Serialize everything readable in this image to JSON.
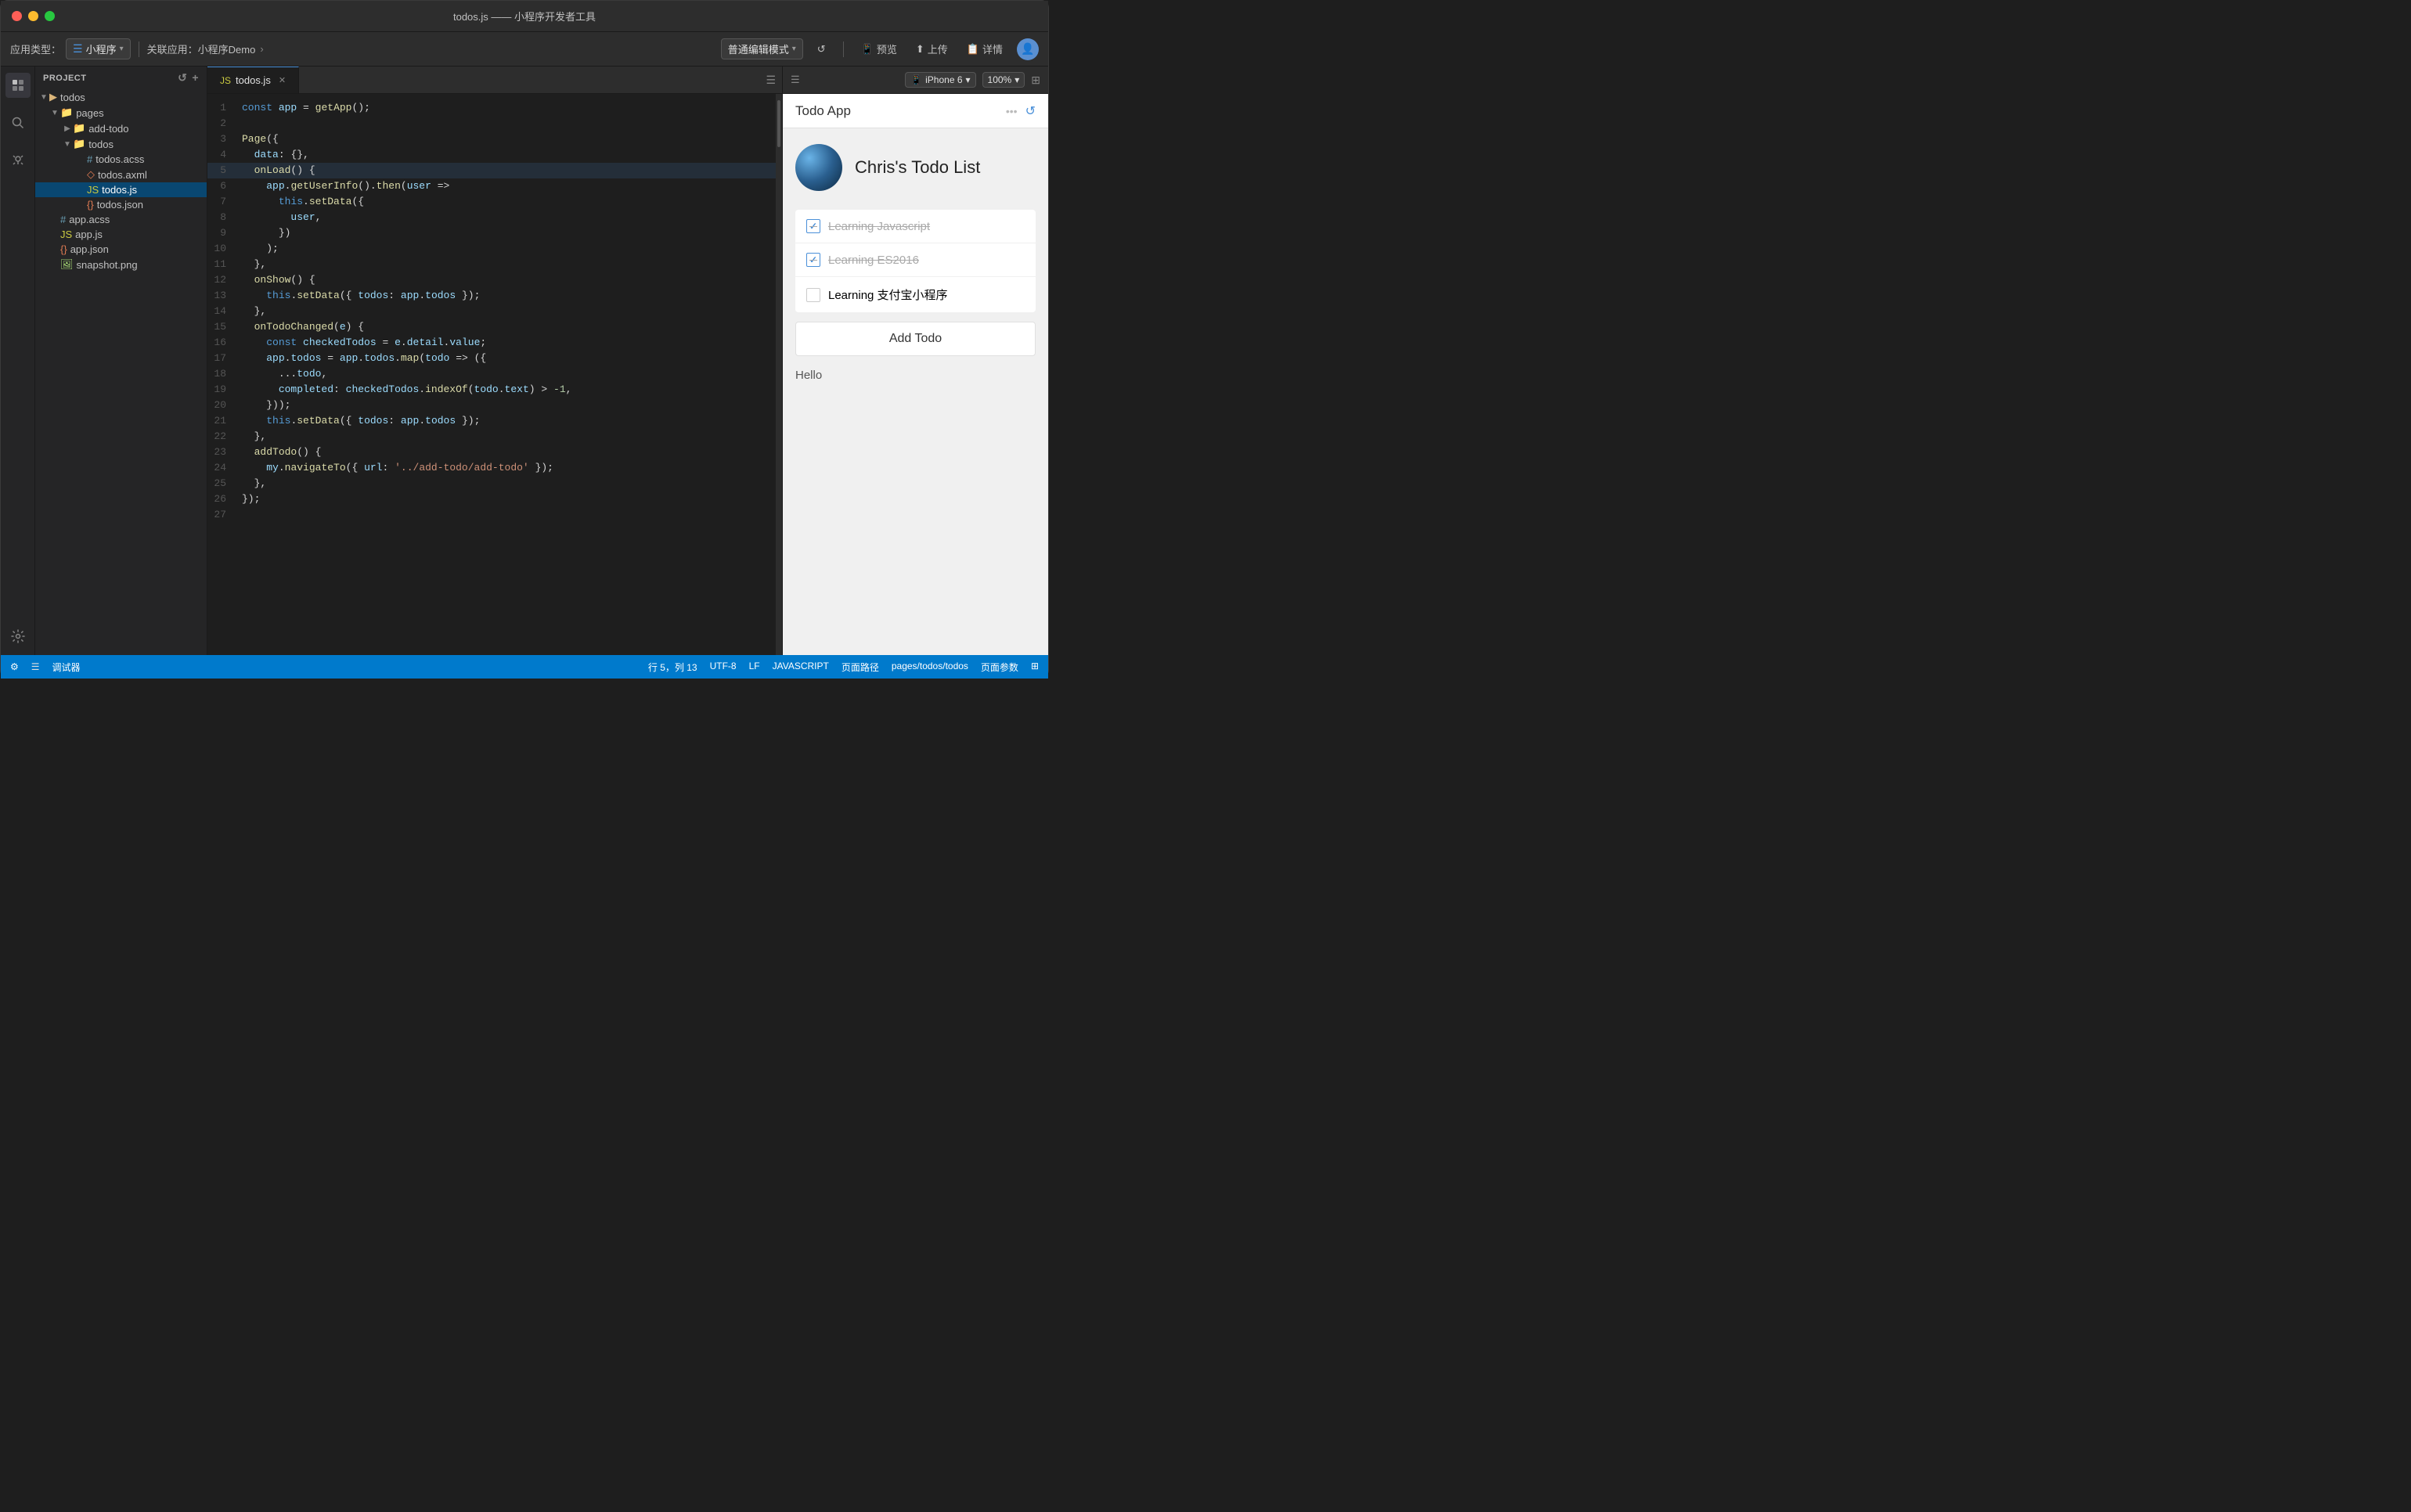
{
  "window": {
    "title": "todos.js —— 小程序开发者工具"
  },
  "toolbar": {
    "app_type_label": "应用类型：",
    "app_type_value": "小程序",
    "related_app_label": "关联应用：小程序Demo",
    "compile_mode": "普通编辑模式",
    "refresh_icon": "↺",
    "preview_label": "预览",
    "upload_label": "上传",
    "detail_label": "详情"
  },
  "sidebar": {
    "title": "Project",
    "root_item": "todos",
    "items": [
      {
        "name": "pages",
        "type": "folder",
        "level": 1
      },
      {
        "name": "add-todo",
        "type": "folder",
        "level": 2
      },
      {
        "name": "todos",
        "type": "folder",
        "level": 2
      },
      {
        "name": "todos.acss",
        "type": "css",
        "level": 3
      },
      {
        "name": "todos.axml",
        "type": "xml",
        "level": 3
      },
      {
        "name": "todos.js",
        "type": "js",
        "level": 3,
        "active": true
      },
      {
        "name": "todos.json",
        "type": "json",
        "level": 3
      },
      {
        "name": "app.acss",
        "type": "css",
        "level": 1
      },
      {
        "name": "app.js",
        "type": "js",
        "level": 1
      },
      {
        "name": "app.json",
        "type": "json",
        "level": 1
      },
      {
        "name": "snapshot.png",
        "type": "img",
        "level": 1
      }
    ]
  },
  "editor": {
    "tab": "todos.js",
    "lines": [
      {
        "n": 1,
        "code": "const app = getApp();"
      },
      {
        "n": 2,
        "code": ""
      },
      {
        "n": 3,
        "code": "Page({"
      },
      {
        "n": 4,
        "code": "  data: {},"
      },
      {
        "n": 5,
        "code": "  onLoad() {",
        "highlight": true
      },
      {
        "n": 6,
        "code": "    app.getUserInfo().then(user =>"
      },
      {
        "n": 7,
        "code": "      this.setData({"
      },
      {
        "n": 8,
        "code": "        user,"
      },
      {
        "n": 9,
        "code": "      })"
      },
      {
        "n": 10,
        "code": "    );"
      },
      {
        "n": 11,
        "code": "  },"
      },
      {
        "n": 12,
        "code": "  onShow() {"
      },
      {
        "n": 13,
        "code": "    this.setData({ todos: app.todos });"
      },
      {
        "n": 14,
        "code": "  },"
      },
      {
        "n": 15,
        "code": "  onTodoChanged(e) {"
      },
      {
        "n": 16,
        "code": "    const checkedTodos = e.detail.value;"
      },
      {
        "n": 17,
        "code": "    app.todos = app.todos.map(todo => ({"
      },
      {
        "n": 18,
        "code": "      ...todo,"
      },
      {
        "n": 19,
        "code": "      completed: checkedTodos.indexOf(todo.text) > -1,"
      },
      {
        "n": 20,
        "code": "    }));"
      },
      {
        "n": 21,
        "code": "    this.setData({ todos: app.todos });"
      },
      {
        "n": 22,
        "code": "  },"
      },
      {
        "n": 23,
        "code": "  addTodo() {"
      },
      {
        "n": 24,
        "code": "    my.navigateTo({ url: '../add-todo/add-todo' });"
      },
      {
        "n": 25,
        "code": "  },"
      },
      {
        "n": 26,
        "code": "});"
      },
      {
        "n": 27,
        "code": ""
      }
    ]
  },
  "preview": {
    "device": "iPhone 6",
    "zoom": "100%",
    "app_title": "Todo App",
    "todo_title": "Chris's Todo List",
    "todos": [
      {
        "text": "Learning Javascript",
        "completed": true
      },
      {
        "text": "Learning ES2016",
        "completed": true
      },
      {
        "text": "Learning 支付宝小程序",
        "completed": false
      }
    ],
    "add_todo_label": "Add Todo",
    "hello_text": "Hello"
  },
  "statusbar": {
    "row_col": "行 5，列 13",
    "encoding": "UTF-8",
    "line_ending": "LF",
    "language": "JAVASCRIPT",
    "page_path_label": "页面路径",
    "page_path": "pages/todos/todos",
    "page_params_label": "页面参数"
  }
}
